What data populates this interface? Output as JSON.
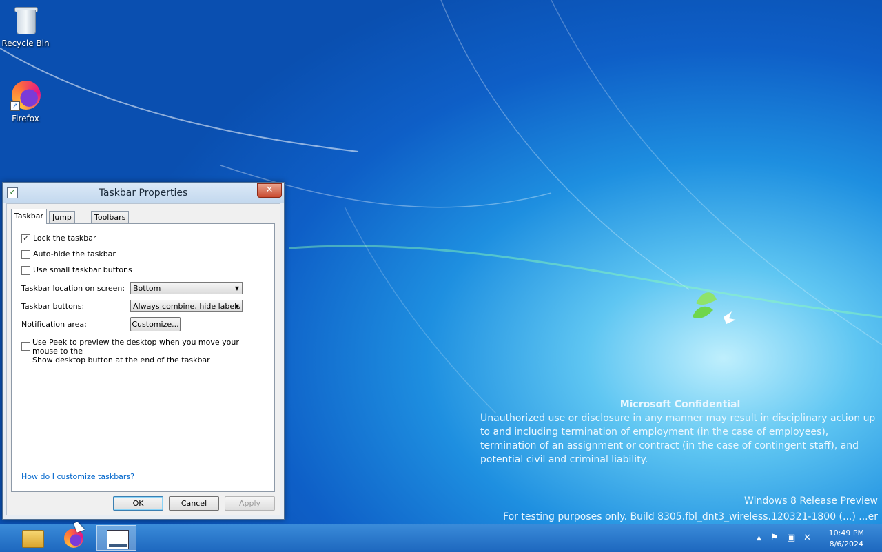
{
  "desktop": {
    "icons": [
      {
        "label": "Recycle Bin",
        "icon": "recycle-bin-icon"
      },
      {
        "label": "Firefox",
        "icon": "firefox-icon"
      }
    ],
    "watermark": {
      "title": "Microsoft Confidential",
      "body": "Unauthorized use or disclosure in any manner may result in disciplinary action up to and including termination of employment (in the case of employees), termination of an assignment or contract (in the case of contingent staff), and potential civil and criminal liability.",
      "edition": "Windows 8 Release Preview",
      "build": "For testing purposes only. Build 8305.fbl_dnt3_wireless.120321-1800 (...) ...er"
    }
  },
  "dialog": {
    "title": "Taskbar Properties",
    "close_label": "✕",
    "tabs": [
      {
        "label": "Taskbar",
        "active": true
      },
      {
        "label": "Jump Lists",
        "active": false
      },
      {
        "label": "Toolbars",
        "active": false
      }
    ],
    "options": {
      "lock": {
        "label": "Lock the taskbar",
        "checked": true
      },
      "autohide": {
        "label": "Auto-hide the taskbar",
        "checked": false
      },
      "small": {
        "label": "Use small taskbar buttons",
        "checked": false
      }
    },
    "location": {
      "label": "Taskbar location on screen:",
      "value": "Bottom"
    },
    "buttons_mode": {
      "label": "Taskbar buttons:",
      "value": "Always combine, hide labels"
    },
    "notification": {
      "label": "Notification area:",
      "button": "Customize..."
    },
    "peek": {
      "line1": "Use Peek to preview the desktop when you move your mouse to the",
      "line2": "Show desktop button at the end of the taskbar",
      "checked": false
    },
    "help_link": "How do I customize taskbars?",
    "footer": {
      "ok": "OK",
      "cancel": "Cancel",
      "apply": "Apply"
    }
  },
  "taskbar": {
    "buttons": [
      {
        "name": "file-explorer",
        "icon": "folder-icon"
      },
      {
        "name": "firefox",
        "icon": "firefox-icon"
      },
      {
        "name": "taskbar-properties",
        "icon": "properties-icon",
        "active": true
      }
    ],
    "tray": {
      "chevron": "▲",
      "time": "10:49 PM",
      "date": "8/6/2024"
    }
  }
}
